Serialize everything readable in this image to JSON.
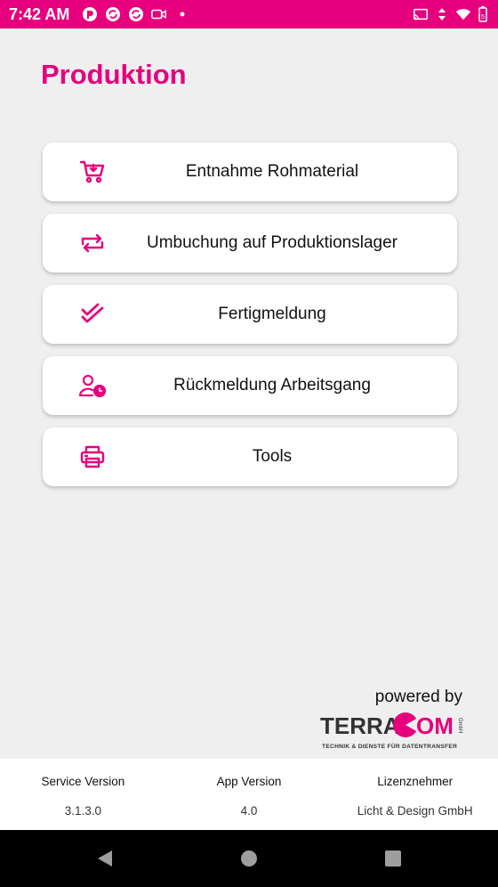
{
  "status_bar": {
    "time": "7:42 AM",
    "left_icons": [
      "app-icon",
      "sync-icon",
      "sync-icon",
      "video-icon",
      "dot-icon"
    ],
    "right_icons": [
      "cast-icon",
      "data-arrows-icon",
      "wifi-icon",
      "battery-icon"
    ],
    "battery_text": "5"
  },
  "page": {
    "title": "Produktion"
  },
  "menu": {
    "items": [
      {
        "label": "Entnahme Rohmaterial",
        "icon": "cart-add-icon"
      },
      {
        "label": "Umbuchung auf Produktionslager",
        "icon": "transfer-icon"
      },
      {
        "label": "Fertigmeldung",
        "icon": "double-check-icon"
      },
      {
        "label": "Rückmeldung Arbeitsgang",
        "icon": "user-clock-icon"
      },
      {
        "label": "Tools",
        "icon": "printer-icon"
      }
    ]
  },
  "branding": {
    "powered_by": "powered by",
    "logo_text_left": "TERRA",
    "logo_text_right": "OM",
    "logo_small": "GmbH",
    "logo_tagline": "TECHNIK & DIENSTE FÜR DATENTRANSFER"
  },
  "footer": {
    "service_version_label": "Service Version",
    "service_version": "3.1.3.0",
    "app_version_label": "App Version",
    "app_version": "4.0",
    "licensee_label": "Lizenznehmer",
    "licensee": "Licht & Design GmbH"
  },
  "colors": {
    "accent": "#e6007e",
    "background": "#efefef"
  }
}
